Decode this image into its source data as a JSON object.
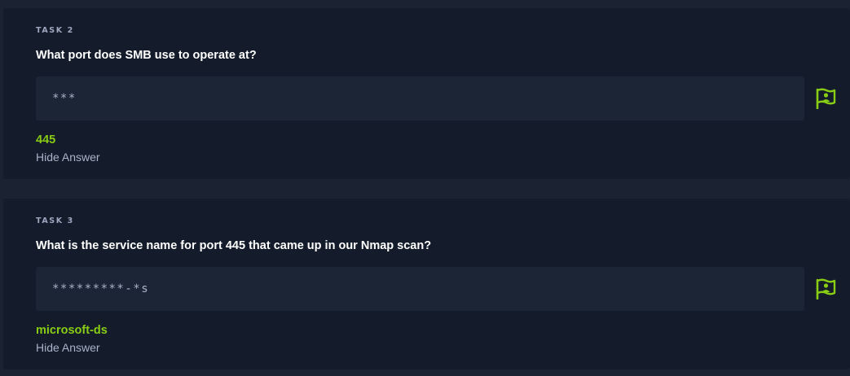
{
  "accent_color": "#88cc14",
  "tasks": [
    {
      "label": "TASK 2",
      "question": "What port does SMB use to operate at?",
      "answer_mask": "***",
      "answer": "445",
      "hide_label": "Hide Answer",
      "hint_icon": "hint-flag-icon"
    },
    {
      "label": "TASK 3",
      "question": "What is the service name for port 445 that came up in our Nmap scan?",
      "answer_mask": "*********-*s",
      "answer": "microsoft-ds",
      "hide_label": "Hide Answer",
      "hint_icon": "hint-flag-icon"
    }
  ]
}
